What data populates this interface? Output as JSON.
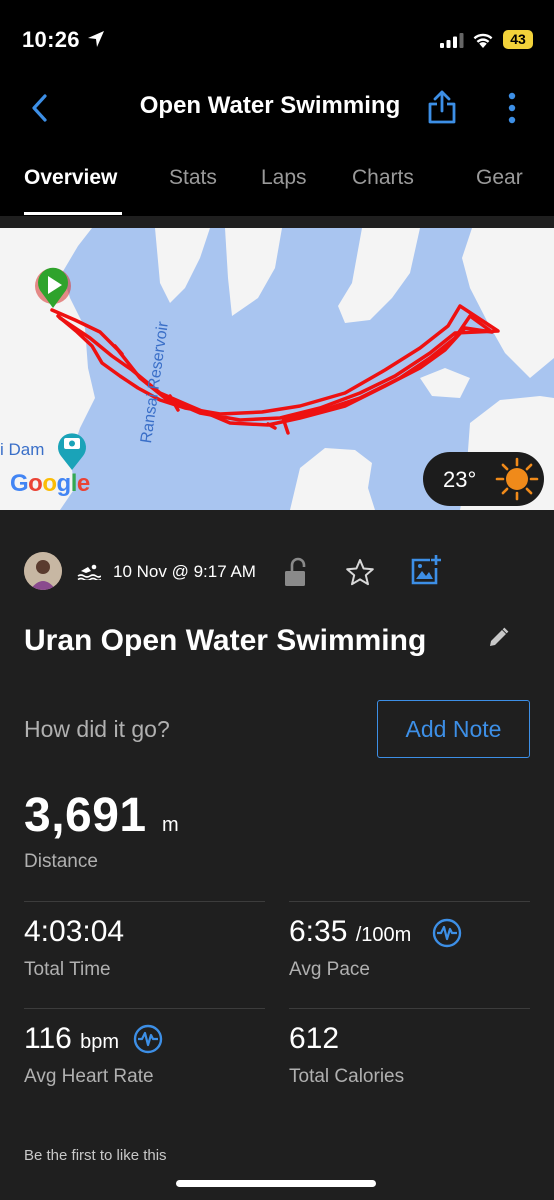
{
  "status_bar": {
    "time": "10:26",
    "battery": "43"
  },
  "header": {
    "title": "Open Water Swimming",
    "tabs": [
      {
        "label": "Overview",
        "active": true
      },
      {
        "label": "Stats",
        "active": false
      },
      {
        "label": "Laps",
        "active": false
      },
      {
        "label": "Charts",
        "active": false
      },
      {
        "label": "Gear",
        "active": false
      }
    ]
  },
  "map": {
    "water_label": "Ransai Reservoir",
    "poi_label": "i Dam",
    "provider_logo": "Google",
    "weather_temp": "23°",
    "route_color": "#ee1111",
    "water_color": "#a9c5f0",
    "land_color": "#f4f4f4"
  },
  "activity": {
    "date": "10 Nov @ 9:17 AM",
    "name": "Uran Open Water Swimming",
    "prompt": "How did it go?",
    "add_note_label": "Add Note"
  },
  "distance": {
    "value": "3,691",
    "unit": "m",
    "label": "Distance"
  },
  "stats": {
    "total_time": {
      "value": "4:03:04",
      "label": "Total Time"
    },
    "avg_pace": {
      "value": "6:35",
      "unit": "/100m",
      "label": "Avg Pace"
    },
    "avg_heart_rate": {
      "value": "116",
      "unit": "bpm",
      "label": "Avg Heart Rate"
    },
    "total_calories": {
      "value": "612",
      "label": "Total Calories"
    }
  },
  "social": {
    "likes_text": "Be the first to like this"
  },
  "colors": {
    "accent": "#3d8fe6",
    "background": "#1f1f1f",
    "header": "#000000"
  }
}
